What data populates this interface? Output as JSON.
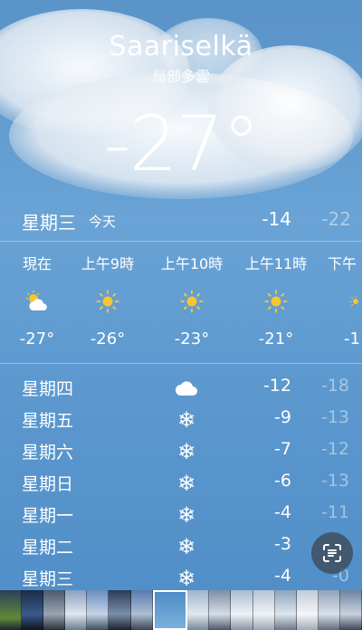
{
  "location": {
    "city": "Saariselkä",
    "condition": "局部多雲",
    "temperature": "-27°"
  },
  "today": {
    "day": "星期三",
    "label": "今天",
    "high": "-14",
    "low": "-22"
  },
  "hourly": [
    {
      "time": "現在",
      "icon": "partly-sunny-icon",
      "temp": "-27°"
    },
    {
      "time": "上午9時",
      "icon": "sun-icon",
      "temp": "-26°"
    },
    {
      "time": "上午10時",
      "icon": "sun-icon",
      "temp": "-23°"
    },
    {
      "time": "上午11時",
      "icon": "sun-icon",
      "temp": "-21°"
    },
    {
      "time": "下午",
      "icon": "sun-icon",
      "temp": "-1"
    }
  ],
  "daily": [
    {
      "day": "星期四",
      "icon": "cloud-icon",
      "high": "-12",
      "low": "-18"
    },
    {
      "day": "星期五",
      "icon": "snow-icon",
      "high": "-9",
      "low": "-13"
    },
    {
      "day": "星期六",
      "icon": "snow-icon",
      "high": "-7",
      "low": "-12"
    },
    {
      "day": "星期日",
      "icon": "snow-icon",
      "high": "-6",
      "low": "-13"
    },
    {
      "day": "星期一",
      "icon": "snow-icon",
      "high": "-4",
      "low": "-11"
    },
    {
      "day": "星期二",
      "icon": "snow-icon",
      "high": "-3",
      "low": ""
    },
    {
      "day": "星期三",
      "icon": "snow-icon",
      "high": "-4",
      "low": "-0"
    }
  ],
  "glyphs": {
    "snow": "❄"
  },
  "colors": {
    "sky": "#5d99cf",
    "sun": "#f7c531"
  }
}
